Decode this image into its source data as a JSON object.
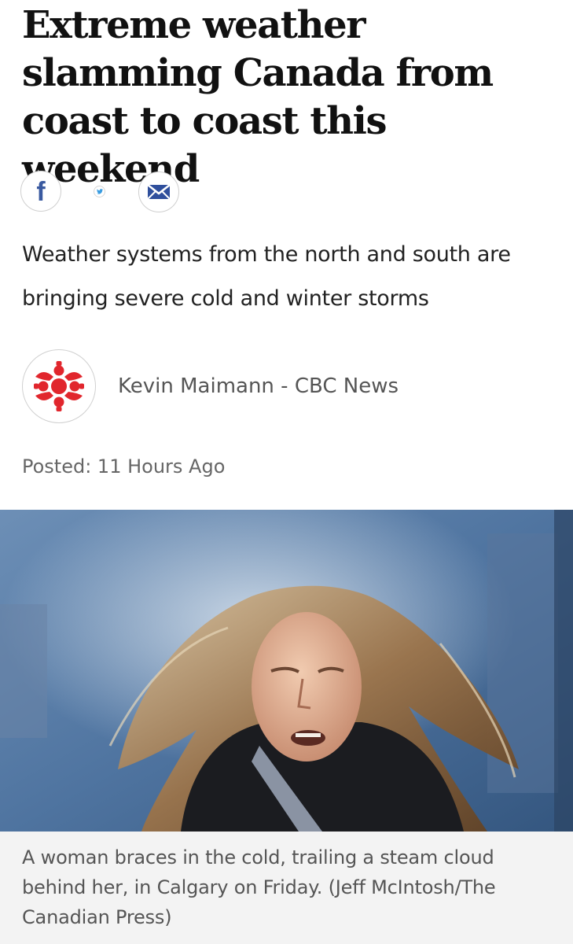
{
  "article": {
    "headline": "Extreme weather slamming Canada from coast to coast this weekend",
    "subhead": "Weather systems from the north and south are bringing severe cold and winter storms",
    "byline": "Kevin Maimann - CBC News",
    "posted": "Posted: 11 Hours Ago",
    "caption": "A woman braces in the cold, trailing a steam cloud behind her, in Calgary on Friday. (Jeff McIntosh/The Canadian Press)"
  },
  "share": {
    "facebook_icon": "facebook-icon",
    "twitter_icon": "twitter-icon",
    "email_icon": "email-icon",
    "facebook_glyph": "f",
    "brand_color": "#1a1a1a"
  },
  "outlet": {
    "logo_icon": "cbc-gem-icon",
    "logo_color": "#e1262d"
  }
}
